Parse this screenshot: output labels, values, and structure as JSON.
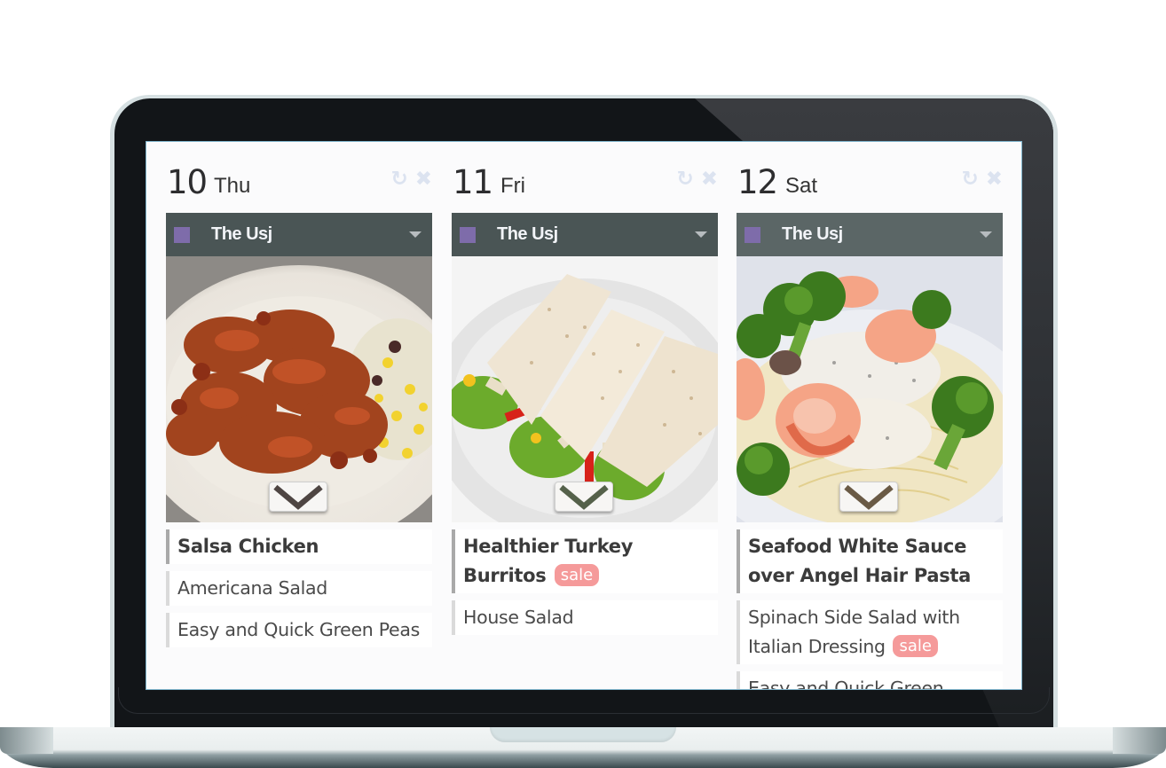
{
  "app": {
    "theme": {
      "restaurant_bar_color": "#4a5555",
      "restaurant_swatch_color": "#7e6caa",
      "sale_badge_color": "#f59a9a",
      "main_item_border_color": "#a9a9a9",
      "side_item_border_color": "#dadada",
      "header_icon_color": "#dce3f0"
    },
    "icons": {
      "refresh": "↻",
      "remove": "✖",
      "dropdown": "caret-down-icon",
      "expand": "chevron-down-icon"
    },
    "days": [
      {
        "day_number": "10",
        "day_name": "Thu",
        "restaurant": "The Usj",
        "image_alt": "Salsa Chicken photo",
        "items": [
          {
            "name": "Salsa Chicken",
            "type": "main",
            "sale": false
          },
          {
            "name": "Americana Salad",
            "type": "side",
            "sale": false
          },
          {
            "name": "Easy and Quick Green Peas",
            "type": "side",
            "sale": false
          }
        ]
      },
      {
        "day_number": "11",
        "day_name": "Fri",
        "restaurant": "The Usj",
        "image_alt": "Healthier Turkey Burritos photo",
        "items": [
          {
            "name": "Healthier Turkey Burritos",
            "type": "main",
            "sale": true
          },
          {
            "name": "House Salad",
            "type": "side",
            "sale": false
          }
        ]
      },
      {
        "day_number": "12",
        "day_name": "Sat",
        "restaurant": "The Usj",
        "image_alt": "Seafood White Sauce over Angel Hair Pasta photo",
        "items": [
          {
            "name": "Seafood White Sauce over Angel Hair Pasta",
            "type": "main",
            "sale": false
          },
          {
            "name": "Spinach Side Salad with Italian Dressing",
            "type": "side",
            "sale": true
          },
          {
            "name": "Easy and Quick Green",
            "type": "side",
            "sale": false
          }
        ]
      }
    ],
    "sale_label": "sale"
  }
}
